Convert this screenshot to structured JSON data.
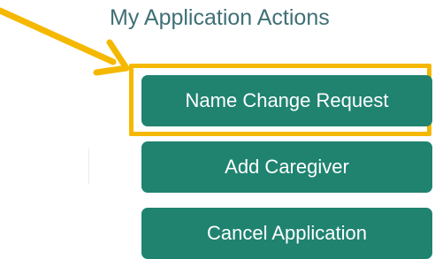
{
  "section": {
    "title": "My Application Actions"
  },
  "actions": [
    {
      "label": "Name Change Request",
      "highlighted": true
    },
    {
      "label": "Add Caregiver",
      "highlighted": false
    },
    {
      "label": "Cancel Application",
      "highlighted": false
    }
  ],
  "annotation": {
    "icon": "arrow-icon",
    "color": "#f5b800"
  },
  "colors": {
    "button": "#1f8370",
    "button_text": "#ffffff",
    "title": "#3f6f76",
    "highlight": "#f5b800"
  }
}
